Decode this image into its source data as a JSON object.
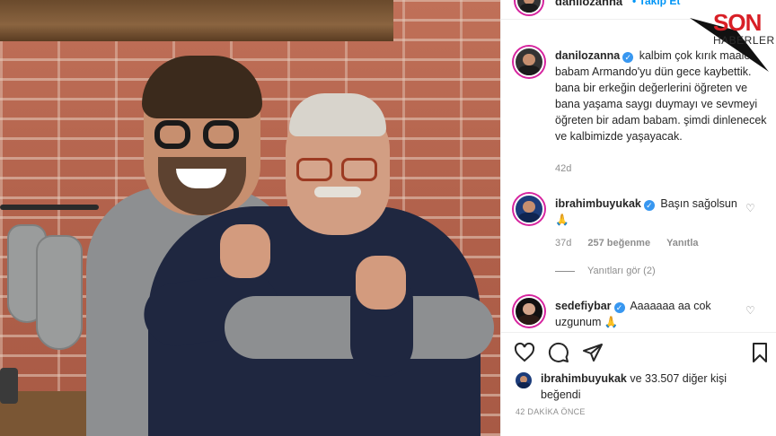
{
  "post": {
    "username": "danilozanna",
    "follow_label": "• Takip Et",
    "caption": "kalbim çok kırık maalesef babam Armando'yu dün gece kaybettik. bana bir erkeğin değerlerini öğreten ve bana yaşama saygı duymayı ve sevmeyi öğreten bir adam babam. şimdi dinlenecek ve kalbimizde yaşayacak.",
    "caption_time": "42d"
  },
  "comments": [
    {
      "username": "ibrahimbuyukak",
      "text": "Başın sağolsun🙏",
      "time": "37d",
      "likes": "257 beğenme",
      "reply": "Yanıtla",
      "view_replies": "Yanıtları gör (2)"
    },
    {
      "username": "sedefiybar",
      "text": "Aaaaaaa aa cok uzgunum 🙏"
    }
  ],
  "liked_by": {
    "username": "ibrahimbuyukak",
    "rest": "ve 33.507 diğer kişi beğendi"
  },
  "posted_ago": "42 DAKİKA ÖNCE",
  "watermark": {
    "line1": "SON",
    "line2": "HABERLER"
  },
  "icons": [
    "heart-icon",
    "comment-icon",
    "share-icon",
    "bookmark-icon",
    "verified-icon"
  ],
  "colors": {
    "link_blue": "#0095f6",
    "verified_blue": "#3897f0",
    "muted_gray": "#8e8e8e",
    "brand_red": "#d81f26"
  }
}
